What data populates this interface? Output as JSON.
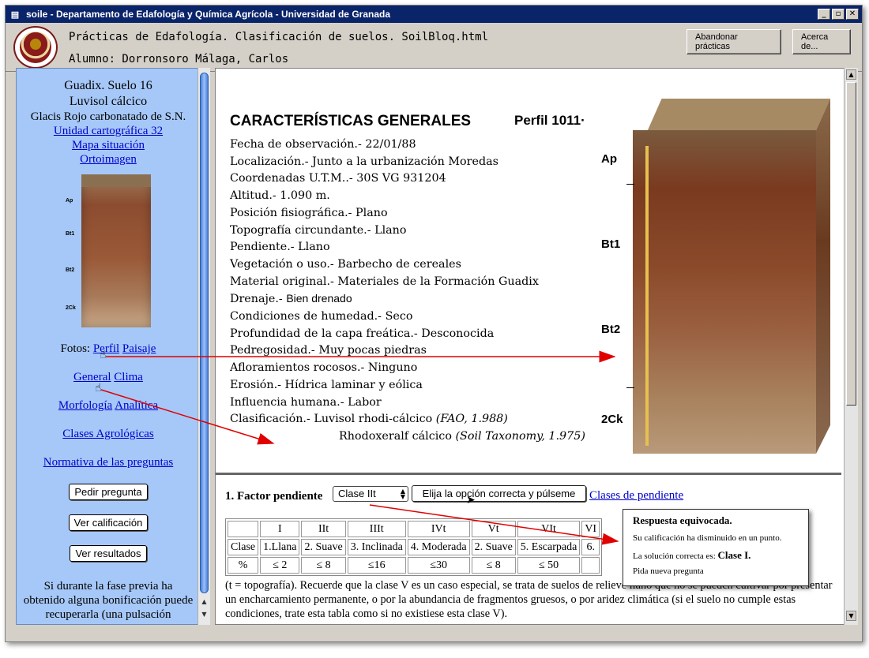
{
  "window": {
    "title": "soile - Departamento de Edafología y Química Agrícola - Universidad de Granada",
    "minimize": "_",
    "maximize": "▫",
    "close": "✕"
  },
  "header": {
    "line1": "Prácticas de Edafología. Clasificación de suelos. SoilBloq.html",
    "line2": "Alumno: Dorronsoro Málaga, Carlos",
    "abandonar_label": "Abandonar prácticas",
    "acerca_label": "Acerca de..."
  },
  "left": {
    "title1": "Guadix. Suelo 16",
    "title2": "Luvisol cálcico",
    "title3": "Glacis Rojo carbonatado de S.N.",
    "link_unidad": "Unidad cartográfica 32",
    "link_mapa": "Mapa situación",
    "link_orto": "Ortoimagen ",
    "thumb_horizons": [
      "Ap",
      "Bt1",
      "Bt2",
      "2Ck"
    ],
    "fotos_label": "Fotos: ",
    "link_perfil": "Perfil",
    "link_paisaje": "Paisaje",
    "link_general": "General",
    "link_clima": "Clima",
    "link_morfologia": "Morfología",
    "link_analitica": "Analítica",
    "link_clases": "Clases Agrológicas",
    "link_normativa": "Normativa de las preguntas",
    "btn_pedir": "Pedir pregunta",
    "btn_calificacion": "Ver calificación",
    "btn_resultados": "Ver resultados",
    "para": "Si durante la fase previa ha obtenido alguna bonificación puede recuperarla (una pulsación"
  },
  "doc": {
    "heading": "CARACTERÍSTICAS GENERALES",
    "perfil": "Perfil 1011·",
    "lines": [
      {
        "label": "Fecha de observación.- ",
        "value": "22/01/88"
      },
      {
        "label": "Localización.- ",
        "value": "Junto a la urbanización Moredas"
      },
      {
        "label": "Coordenadas U.T.M..- ",
        "value": "30S VG 931204"
      },
      {
        "label": "Altitud.- ",
        "value": "1.090 m."
      },
      {
        "label": "Posición fisiográfica.- ",
        "value": "Plano"
      },
      {
        "label": "Topografía circundante.- ",
        "value": "Llano"
      },
      {
        "label": "Pendiente.- ",
        "value": "Llano"
      },
      {
        "label": "Vegetación o uso.- ",
        "value": "Barbecho de cereales"
      },
      {
        "label": "Material original.- ",
        "value": "Materiales de la Formación Guadix"
      },
      {
        "label": "Drenaje.- ",
        "value": "Bien drenado"
      },
      {
        "label": "Condiciones de humedad.- ",
        "value": "Seco"
      },
      {
        "label": "Profundidad de la capa freática.- ",
        "value": "Desconocida"
      },
      {
        "label": "Pedregosidad.- ",
        "value": "Muy pocas piedras"
      },
      {
        "label": "Afloramientos rocosos.- ",
        "value": "Ninguno"
      },
      {
        "label": "Erosión.- ",
        "value": "Hídrica laminar y eólica"
      },
      {
        "label": "Influencia humana.- ",
        "value": "Labor"
      },
      {
        "label": "Clasificación.- ",
        "value": "Luvisol rhodi-cálcico ",
        "ref": "(FAO, 1.988)"
      }
    ],
    "last_line_value": "Rhodoxeralf cálcico ",
    "last_line_ref": "(Soil Taxonomy, 1.975)",
    "horizons": [
      "Ap",
      "Bt1",
      "Bt2",
      "2Ck"
    ]
  },
  "question": {
    "title": "1. Factor pendiente",
    "select_value": "Clase IIt",
    "submit_label": "Elija la opción correcta y púlseme",
    "link_label": "Clases de pendiente",
    "table": {
      "header": [
        "",
        "I",
        "IIt",
        "IIIt",
        "IVt",
        "Vt",
        "VIt",
        "VI"
      ],
      "row_clase": [
        "Clase",
        "1.Llana",
        "2. Suave",
        "3. Inclinada",
        "4. Moderada",
        "2. Suave",
        "5. Escarpada",
        "6."
      ],
      "row_pct": [
        "%",
        "≤ 2",
        "≤ 8",
        "≤16",
        "≤30",
        "≤ 8",
        "≤ 50",
        ""
      ]
    },
    "notes": "(t = topografía). Recuerde que la clase V es un caso especial, se trata de suelos de relieve llano que no se pueden cultivar por presentar un encharcamiento permanente, o por la abundancia de fragmentos gruesos, o por aridez climática (si el suelo no cumple estas condiciones, trate esta tabla como si no existiese esta clase V)."
  },
  "popup": {
    "title": "Respuesta equivocada.",
    "line1": "Su calificación ha disminuido en un punto.",
    "line2_prefix": "La solución correcta es: ",
    "line2_answer": "Clase I.",
    "line3": "Pida nueva pregunta"
  },
  "colors": {
    "titlebar": "#0a246a",
    "left_panel": "#a6c8f8",
    "link": "#0000cc",
    "arrow": "#e00000"
  }
}
